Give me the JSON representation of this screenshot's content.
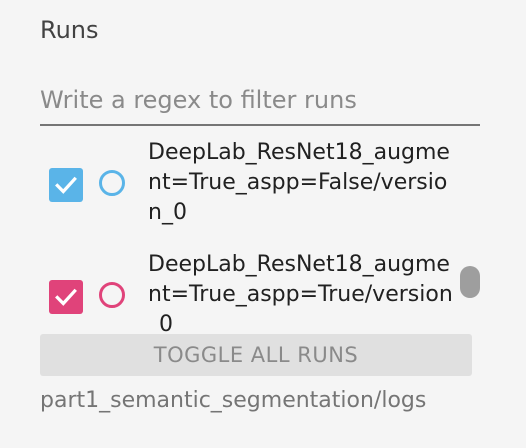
{
  "section": {
    "title": "Runs"
  },
  "filter": {
    "placeholder": "Write a regex to filter runs",
    "value": ""
  },
  "runs": [
    {
      "name": "DeepLab_ResNet18_augment=True_aspp=False/version_0",
      "checked": true,
      "color": "#5ab4e8",
      "checkmark": "check-icon"
    },
    {
      "name": "DeepLab_ResNet18_augment=True_aspp=True/version_0",
      "checked": true,
      "color": "#e0437a",
      "checkmark": "check-icon"
    }
  ],
  "toggle": {
    "label": "TOGGLE ALL RUNS"
  },
  "logdir": "part1_semantic_segmentation/logs",
  "colors": {
    "disabled_bg": "#e0e0e0",
    "scroll_thumb": "#9e9e9e"
  }
}
